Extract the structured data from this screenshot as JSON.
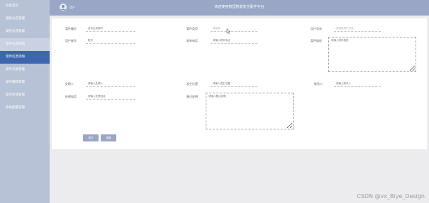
{
  "sidebar": {
    "items": [
      {
        "label": "后台首页"
      },
      {
        "label": "通知公告管理"
      },
      {
        "label": "案件信息管理"
      },
      {
        "label": "案件信息添加"
      },
      {
        "label": "案件信息添加"
      },
      {
        "label": "案件记录管理"
      },
      {
        "label": "案件跟踪管理"
      },
      {
        "label": "案件反馈管理"
      },
      {
        "label": "系统配置管理"
      }
    ]
  },
  "header": {
    "user": "用户",
    "title": "欢迎使用校园智能安全助手平台"
  },
  "form": {
    "case_no": {
      "label": "案件编号",
      "placeholder": "自动生成编号"
    },
    "case_type": {
      "label": "案件类型",
      "value": "请选择"
    },
    "user_status": {
      "label": "用户状态",
      "value": "请选择用户状态"
    },
    "user_id": {
      "label": "用户账号",
      "placeholder": "账号"
    },
    "contact": {
      "label": "联系电话",
      "placeholder": "请输入联系电话"
    },
    "case_detail": {
      "label": "案件描述",
      "placeholder": "请输入案件描述"
    },
    "handler": {
      "label": "处理人",
      "placeholder": "请输入处理人"
    },
    "location": {
      "label": "发生位置",
      "placeholder": "请输入发生位置"
    },
    "contact_person": {
      "label": "联系人",
      "placeholder": "请输入联系人"
    },
    "handler_phone": {
      "label": "处理电话",
      "placeholder": "请输入处理电话"
    },
    "remark": {
      "label": "备注说明",
      "placeholder": "请输入备注说明"
    }
  },
  "buttons": {
    "submit": "提交",
    "reset": "重置"
  },
  "watermark": "CSDN @vx_Biye_Design"
}
